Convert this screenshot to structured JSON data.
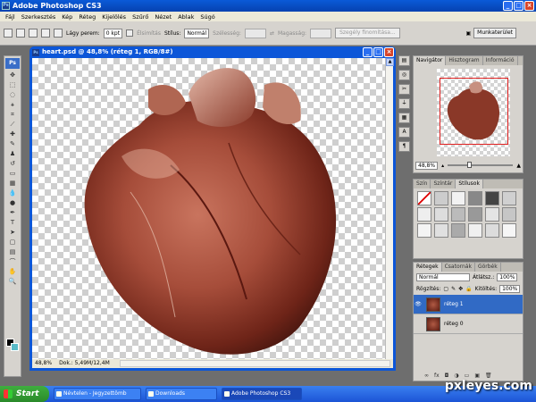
{
  "app": {
    "title": "Adobe Photoshop CS3",
    "logo": "Ps"
  },
  "menu": [
    "Fájl",
    "Szerkesztés",
    "Kép",
    "Réteg",
    "Kijelölés",
    "Szűrő",
    "Nézet",
    "Ablak",
    "Súgó"
  ],
  "options": {
    "feather_label": "Lágy perem:",
    "feather_value": "0 kpt",
    "antialias_label": "Élsimítás",
    "style_label": "Stílus:",
    "style_value": "Normál",
    "width_label": "Szélesség:",
    "height_label": "Magasság:",
    "refine_edge": "Szegély finomítása...",
    "workspace": "Munkaterület"
  },
  "document": {
    "title": "heart.psd @ 48,8% (réteg 1, RGB/8#)",
    "zoom": "48,8%",
    "doc_size": "Dok.: 5,49M/12,4M"
  },
  "navigator": {
    "tabs": [
      "Navigátor",
      "Hisztogram",
      "Információ"
    ],
    "zoom": "48,8%"
  },
  "styles_panel": {
    "tabs": [
      "Szín",
      "Színtár",
      "Stílusok"
    ]
  },
  "layers_panel": {
    "tabs": [
      "Rétegek",
      "Csatornák",
      "Görbék"
    ],
    "blend_mode": "Normál",
    "opacity_label": "Átlátsz.:",
    "opacity": "100%",
    "lock_label": "Rögzítés:",
    "fill_label": "Kitöltés:",
    "fill": "100%",
    "layers": [
      {
        "name": "réteg 1",
        "selected": true,
        "visible": true
      },
      {
        "name": "réteg 0",
        "selected": false,
        "visible": false
      }
    ]
  },
  "taskbar": {
    "start": "Start",
    "tasks": [
      "Névtelen - Jegyzettömb",
      "Downloads",
      "Adobe Photoshop CS3"
    ]
  },
  "watermark": "pxleyes.com",
  "colors": {
    "foreground": "#000000",
    "background": "#59bac7",
    "accent": "#0c56d8"
  }
}
